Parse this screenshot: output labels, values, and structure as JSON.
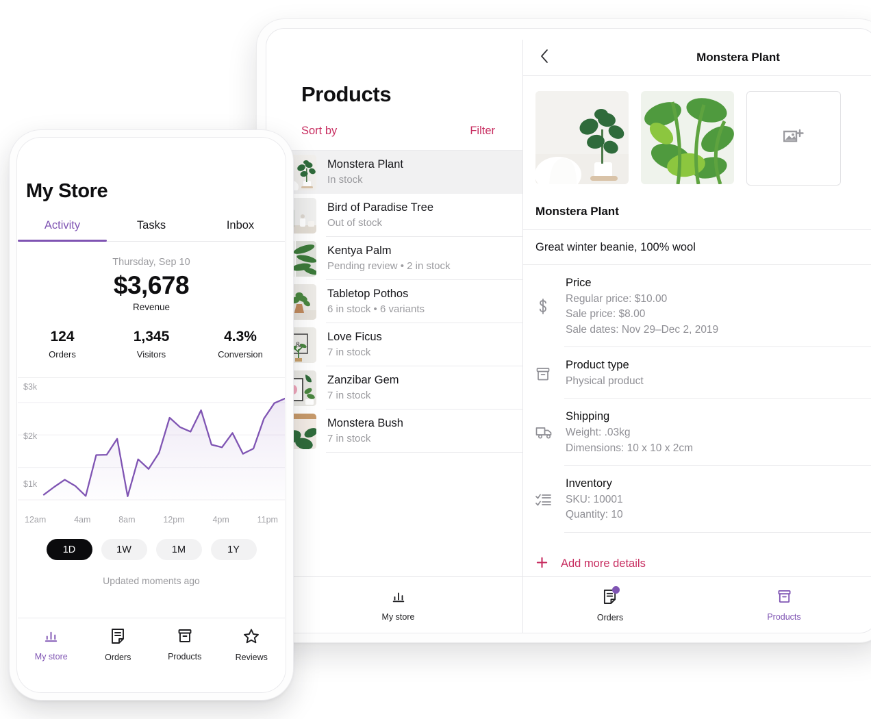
{
  "phone": {
    "title": "My Store",
    "tabs": [
      {
        "label": "Activity",
        "active": true
      },
      {
        "label": "Tasks",
        "active": false
      },
      {
        "label": "Inbox",
        "active": false
      }
    ],
    "stats": {
      "date": "Thursday, Sep 10",
      "revenue": "$3,678",
      "revenue_label": "Revenue",
      "kpis": [
        {
          "value": "124",
          "label": "Orders"
        },
        {
          "value": "1,345",
          "label": "Visitors"
        },
        {
          "value": "4.3%",
          "label": "Conversion"
        }
      ]
    },
    "range_options": [
      {
        "label": "1D",
        "active": true
      },
      {
        "label": "1W",
        "active": false
      },
      {
        "label": "1M",
        "active": false
      },
      {
        "label": "1Y",
        "active": false
      }
    ],
    "updated": "Updated moments ago",
    "nav": [
      {
        "label": "My store",
        "icon": "bar-chart-icon",
        "active": true
      },
      {
        "label": "Orders",
        "icon": "orders-document-icon",
        "active": false
      },
      {
        "label": "Products",
        "icon": "box-icon",
        "active": false
      },
      {
        "label": "Reviews",
        "icon": "star-icon",
        "active": false
      }
    ]
  },
  "tablet": {
    "products_panel": {
      "title": "Products",
      "sort_by_label": "Sort by",
      "filter_label": "Filter",
      "items": [
        {
          "name": "Monstera Plant",
          "status": "In stock",
          "selected": true
        },
        {
          "name": "Bird of Paradise Tree",
          "status": "Out of stock",
          "selected": false
        },
        {
          "name": "Kentya Palm",
          "status": "Pending review • 2 in stock",
          "selected": false
        },
        {
          "name": "Tabletop Pothos",
          "status": "6 in stock • 6 variants",
          "selected": false
        },
        {
          "name": "Love Ficus",
          "status": "7 in stock",
          "selected": false
        },
        {
          "name": "Zanzibar Gem",
          "status": "7 in stock",
          "selected": false
        },
        {
          "name": "Monstera Bush",
          "status": "7 in stock",
          "selected": false
        }
      ],
      "nav": [
        {
          "label": "My store",
          "icon": "bar-chart-icon",
          "active": false
        }
      ]
    },
    "detail_panel": {
      "back_icon": "chevron-left-icon",
      "header_title": "Monstera Plant",
      "gallery": [
        {
          "name": "product-photo-1",
          "icon": ""
        },
        {
          "name": "product-photo-2",
          "icon": ""
        },
        {
          "name": "add-photo-placeholder",
          "icon": "add-image-icon"
        }
      ],
      "product_name": "Monstera Plant",
      "description": "Great winter beanie, 100% wool",
      "rows": [
        {
          "icon": "dollar-icon",
          "heading": "Price",
          "lines": [
            "Regular price: $10.00",
            "Sale price: $8.00",
            "Sale dates: Nov 29–Dec 2, 2019"
          ]
        },
        {
          "icon": "box-icon",
          "heading": "Product type",
          "lines": [
            "Physical product"
          ]
        },
        {
          "icon": "truck-icon",
          "heading": "Shipping",
          "lines": [
            "Weight: .03kg",
            "Dimensions: 10 x 10 x 2cm"
          ]
        },
        {
          "icon": "checklist-icon",
          "heading": "Inventory",
          "lines": [
            "SKU: 10001",
            "Quantity: 10"
          ]
        }
      ],
      "add_more_label": "Add more details",
      "add_more_icon": "plus-icon",
      "nav": [
        {
          "label": "Orders",
          "icon": "orders-document-icon",
          "active": false,
          "badge": true
        },
        {
          "label": "Products",
          "icon": "box-icon",
          "active": true,
          "badge": false
        }
      ]
    }
  },
  "colors": {
    "purple": "#7f54b3",
    "crimson": "#c72c5f",
    "black": "#0b0b0d",
    "muted": "#9b9b9f"
  },
  "chart_data": {
    "type": "line",
    "title": "Revenue",
    "xlabel": "",
    "ylabel": "",
    "ylim": [
      0,
      3500
    ],
    "grid": true,
    "ytick_labels": [
      "$1k",
      "$2k",
      "$3k"
    ],
    "ytick_values": [
      1000,
      2000,
      3000
    ],
    "xtick_labels": [
      "12am",
      "4am",
      "8am",
      "12pm",
      "4pm",
      "11pm"
    ],
    "legend": "none",
    "series": [
      {
        "name": "Revenue",
        "color": "#7f54b3",
        "x": [
          "12am",
          "1am",
          "2am",
          "3am",
          "4am",
          "5am",
          "6am",
          "7am",
          "8am",
          "9am",
          "10am",
          "11am",
          "12pm",
          "1pm",
          "2pm",
          "3pm",
          "4pm",
          "5pm",
          "6pm",
          "7pm",
          "8pm",
          "9pm",
          "10pm",
          "11pm"
        ],
        "values": [
          160,
          400,
          620,
          430,
          120,
          1380,
          1390,
          1880,
          110,
          1250,
          950,
          1450,
          2530,
          2240,
          2100,
          2760,
          1700,
          1620,
          2060,
          1420,
          1580,
          2500,
          2980,
          3120
        ]
      }
    ]
  }
}
